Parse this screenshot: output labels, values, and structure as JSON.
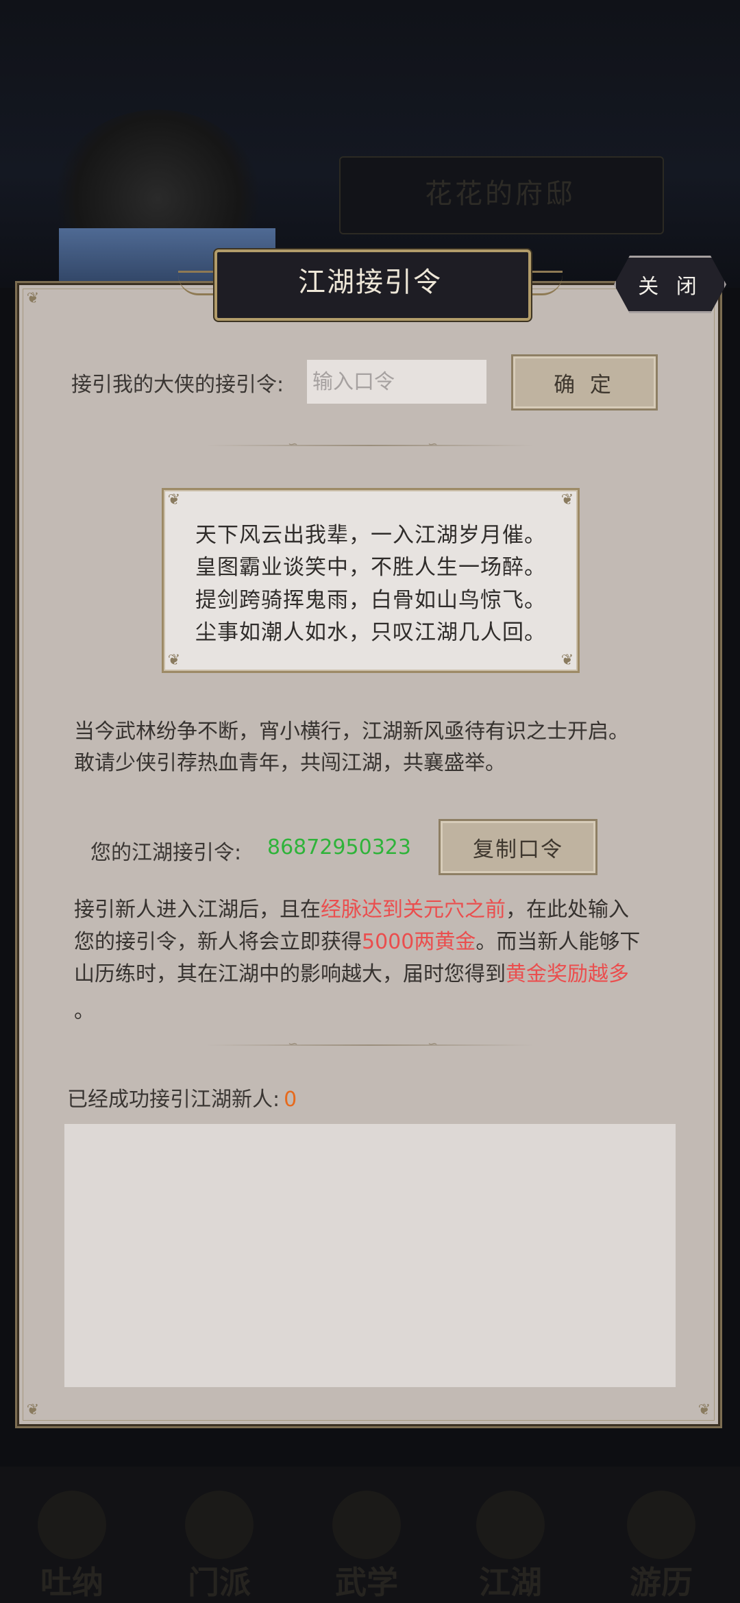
{
  "background": {
    "mansion_title": "花花的府邸",
    "bottom_nav": [
      "吐纳",
      "门派",
      "武学",
      "江湖",
      "游历"
    ]
  },
  "dialog": {
    "title": "江湖接引令",
    "close_label": "关 闭",
    "enter_code": {
      "label": "接引我的大侠的接引令:",
      "placeholder": "输入口令",
      "value": "",
      "confirm_label": "确 定"
    },
    "poem": [
      "天下风云出我辈，一入江湖岁月催。",
      "皇图霸业谈笑中，不胜人生一场醉。",
      "提剑跨骑挥鬼雨，白骨如山鸟惊飞。",
      "尘事如潮人如水，只叹江湖几人回。"
    ],
    "intro": [
      "当今武林纷争不断，宵小横行，江湖新风亟待有识之士开启。",
      "敢请少侠引荐热血青年，共闯江湖，共襄盛举。"
    ],
    "my_code": {
      "label": "您的江湖接引令:",
      "value": "86872950323",
      "copy_label": "复制口令"
    },
    "rules": {
      "p1": "接引新人进入江湖后，且在",
      "h1": "经脉达到关元穴之前",
      "p2": "，在此处输入",
      "p3": "您的接引令，新人将会立即获得",
      "h2": "5000两黄金",
      "p4": "。而当新人能够下",
      "p5": "山历练时，其在江湖中的影响越大，届时您得到",
      "h3": "黄金奖励越多",
      "p6": "。"
    },
    "success": {
      "label": "已经成功接引江湖新人:",
      "count": "0"
    },
    "colors": {
      "code_green": "#2fb33a",
      "highlight_red": "#ea4e4e",
      "count_orange": "#e66a1d"
    }
  }
}
